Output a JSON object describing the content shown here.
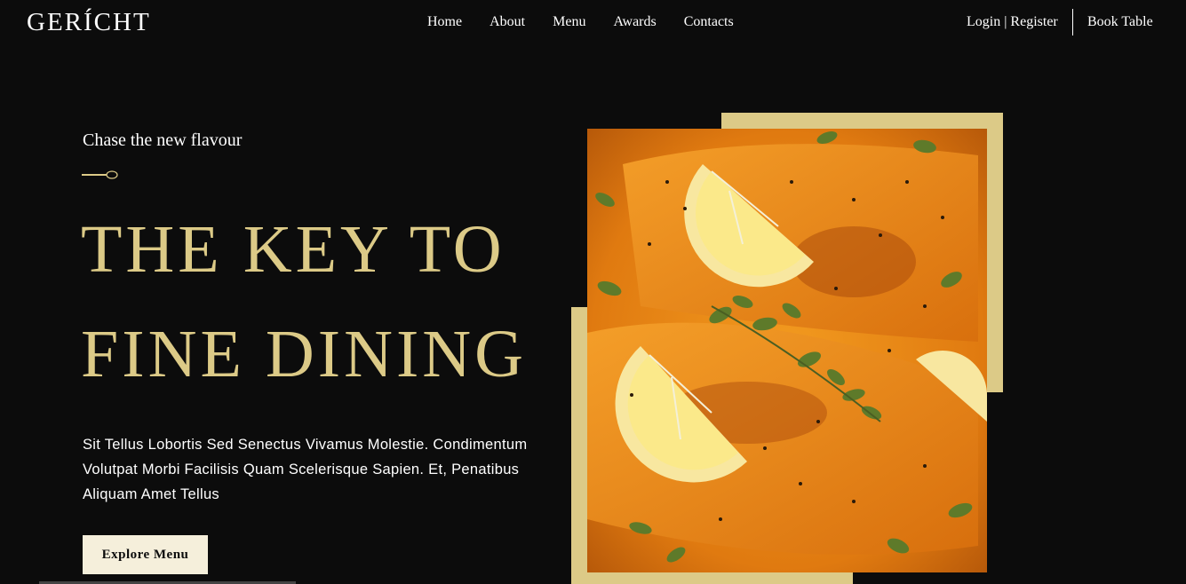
{
  "brand": {
    "logo": "GERÍCHT"
  },
  "nav": {
    "links": [
      "Home",
      "About",
      "Menu",
      "Awards",
      "Contacts"
    ],
    "login": "Login",
    "separator": " | ",
    "register": "Register",
    "book_table": "Book Table"
  },
  "hero": {
    "subtitle": "Chase the new flavour",
    "headline_line1": "THE KEY TO",
    "headline_line2": "FINE DINING",
    "description": "Sit Tellus Lobortis Sed Senectus Vivamus Molestie. Condimentum Volutpat Morbi Facilisis Quam Scelerisque Sapien. Et, Penatibus Aliquam Amet Tellus",
    "button_label": "Explore Menu",
    "image_icon": "salmon-dish-image"
  },
  "colors": {
    "background": "#0c0c0c",
    "accent_gold": "#dcca87",
    "button_bg": "#f5efdb",
    "text": "#ffffff"
  }
}
